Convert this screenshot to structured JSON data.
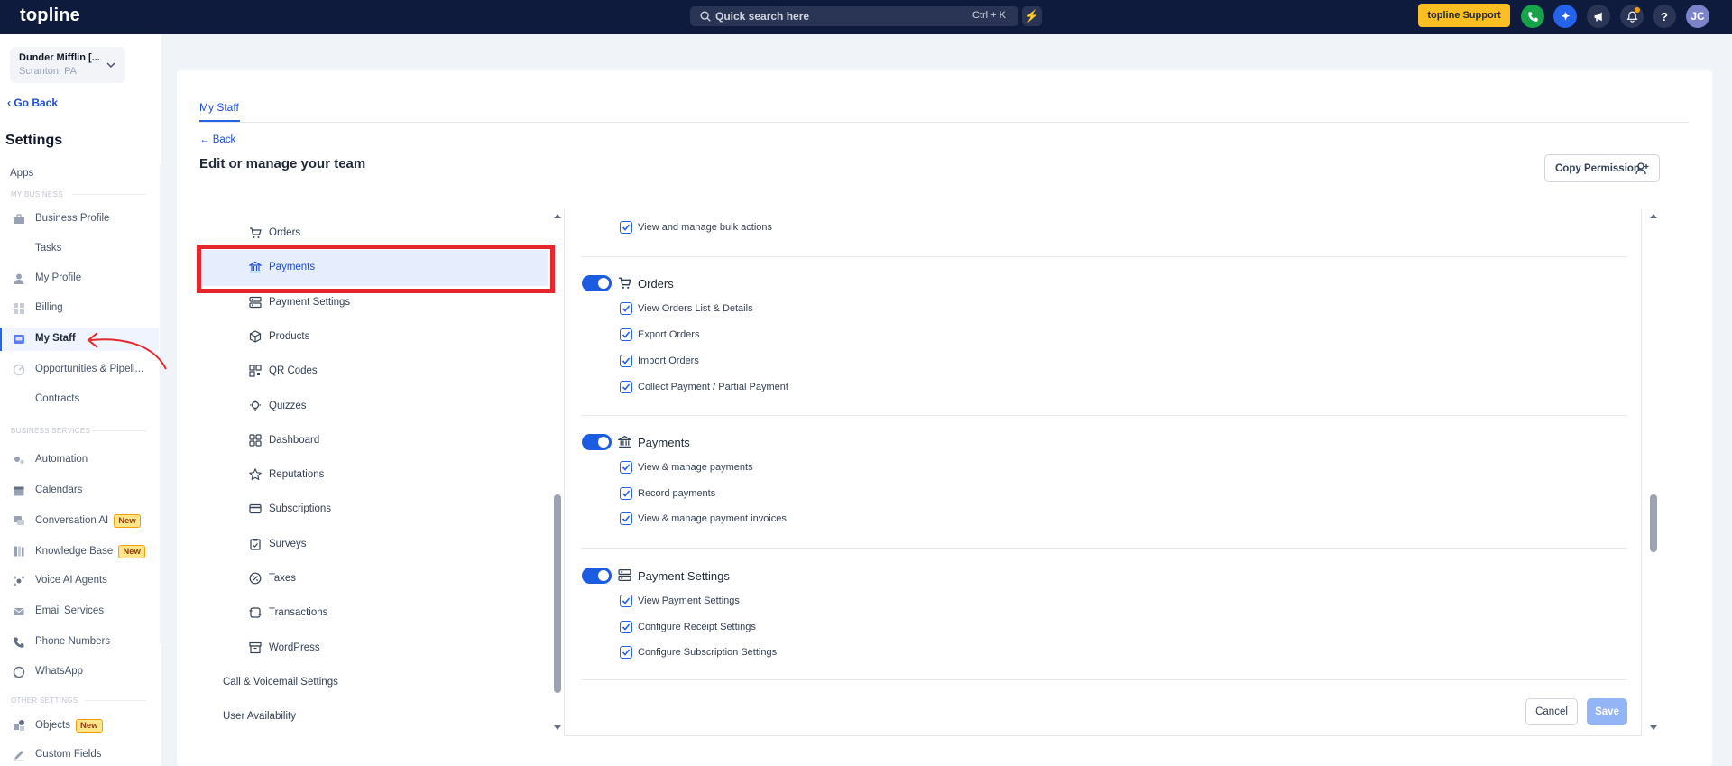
{
  "topbar": {
    "logo": "topline",
    "search_placeholder": "Quick search here",
    "search_shortcut": "Ctrl + K",
    "support_label": "topline Support",
    "help_label": "?",
    "avatar_initials": "JC"
  },
  "sidebar": {
    "account_name": "Dunder Mifflin [...",
    "account_location": "Scranton, PA",
    "go_back": "Go Back",
    "title": "Settings",
    "apps_label": "Apps",
    "section_my_business": "MY BUSINESS",
    "section_business_services": "BUSINESS SERVICES",
    "section_other_settings": "OTHER SETTINGS",
    "items": [
      {
        "label": "Business Profile",
        "icon": "briefcase-icon"
      },
      {
        "label": "Tasks",
        "icon": ""
      },
      {
        "label": "My Profile",
        "icon": "user-icon"
      },
      {
        "label": "Billing",
        "icon": "grid-icon"
      },
      {
        "label": "My Staff",
        "icon": "staff-icon"
      },
      {
        "label": "Opportunities & Pipeli...",
        "icon": "funnel-icon"
      },
      {
        "label": "Contracts",
        "icon": ""
      },
      {
        "label": "Automation",
        "icon": "gears-icon"
      },
      {
        "label": "Calendars",
        "icon": "calendar-icon"
      },
      {
        "label": "Conversation AI",
        "icon": "chat-icon",
        "badge": "New"
      },
      {
        "label": "Knowledge Base",
        "icon": "book-icon",
        "badge": "New"
      },
      {
        "label": "Voice AI Agents",
        "icon": "voice-icon"
      },
      {
        "label": "Email Services",
        "icon": "mail-icon"
      },
      {
        "label": "Phone Numbers",
        "icon": "phone-icon"
      },
      {
        "label": "WhatsApp",
        "icon": "whatsapp-icon"
      },
      {
        "label": "Objects",
        "icon": "objects-icon",
        "badge": "New"
      },
      {
        "label": "Custom Fields",
        "icon": "pencil-icon"
      }
    ]
  },
  "main": {
    "tab": "My Staff",
    "back": "Back",
    "heading": "Edit or manage your team",
    "copy_permission": "Copy Permission",
    "cancel": "Cancel",
    "save": "Save"
  },
  "permission_list": [
    {
      "label": "Orders",
      "icon": "cart-icon"
    },
    {
      "label": "Payments",
      "icon": "bank-icon",
      "selected": true
    },
    {
      "label": "Payment Settings",
      "icon": "settings-icon"
    },
    {
      "label": "Products",
      "icon": "box-icon"
    },
    {
      "label": "QR Codes",
      "icon": "qr-icon"
    },
    {
      "label": "Quizzes",
      "icon": "bulb-icon"
    },
    {
      "label": "Dashboard",
      "icon": "dashboard-icon"
    },
    {
      "label": "Reputations",
      "icon": "star-icon"
    },
    {
      "label": "Subscriptions",
      "icon": "card-icon"
    },
    {
      "label": "Surveys",
      "icon": "clipboard-icon"
    },
    {
      "label": "Taxes",
      "icon": "percent-icon"
    },
    {
      "label": "Transactions",
      "icon": "exchange-icon"
    },
    {
      "label": "WordPress",
      "icon": "archive-icon"
    },
    {
      "label": "Call & Voicemail Settings",
      "icon": ""
    },
    {
      "label": "User Availability",
      "icon": ""
    }
  ],
  "permission_groups": {
    "prev_item": "View and manage bulk actions",
    "orders": {
      "title": "Orders",
      "enabled": true,
      "items": [
        "View Orders List & Details",
        "Export Orders",
        "Import Orders",
        "Collect Payment / Partial Payment"
      ]
    },
    "payments": {
      "title": "Payments",
      "enabled": true,
      "items": [
        "View & manage payments",
        "Record payments",
        "View & manage payment invoices"
      ]
    },
    "payment_settings": {
      "title": "Payment Settings",
      "enabled": true,
      "items": [
        "View Payment Settings",
        "Configure Receipt Settings",
        "Configure Subscription Settings"
      ]
    }
  },
  "colors": {
    "topbar": "#0f1b3d",
    "accent": "#2563eb",
    "highlight_box": "#e5262c",
    "support_button": "#fbbf24"
  }
}
